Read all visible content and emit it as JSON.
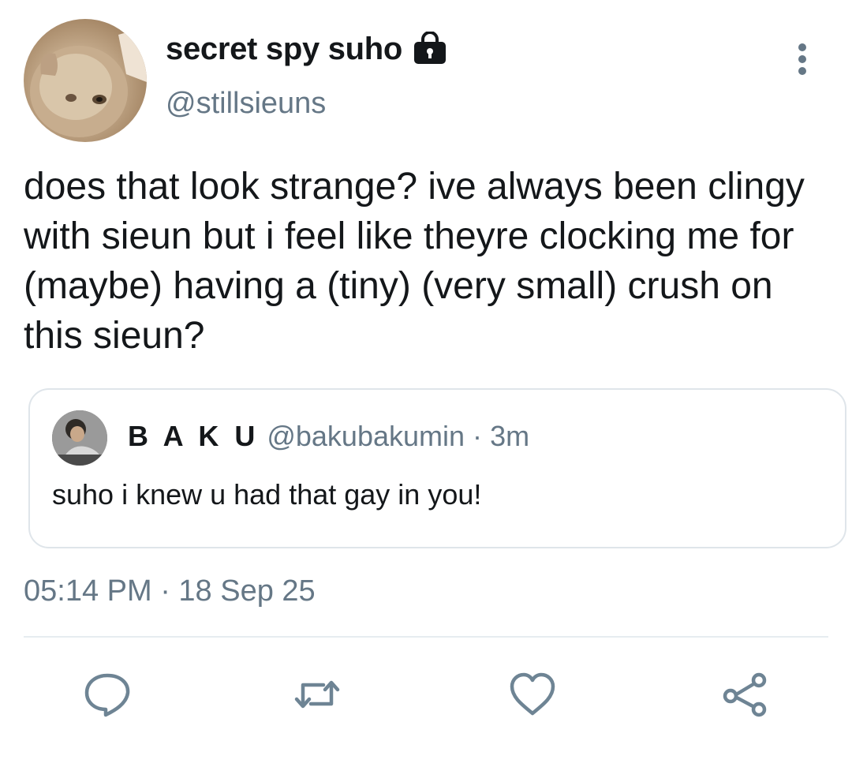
{
  "author": {
    "display_name": "secret spy suho",
    "handle": "@stillsieuns",
    "protected_icon": "lock-icon",
    "avatar_icon": "cat-avatar"
  },
  "menu_icon": "more-vertical-icon",
  "tweet": {
    "text": "does that look strange? ive always been clingy with sieun but i feel like theyre clocking me for (maybe) having a (tiny) (very small) crush on this sieun?",
    "timestamp": "05:14 PM · 18 Sep 25"
  },
  "quoted_tweet": {
    "name": "B A K U",
    "handle": "@bakubakumin",
    "separator": "·",
    "time": "3m",
    "text": "suho i knew u had that gay in you!",
    "avatar_icon": "user-photo-avatar"
  },
  "actions": [
    {
      "name": "reply",
      "icon": "speech-bubble-icon"
    },
    {
      "name": "retweet",
      "icon": "retweet-arrows-icon"
    },
    {
      "name": "like",
      "icon": "heart-icon"
    },
    {
      "name": "share",
      "icon": "share-nodes-icon"
    }
  ],
  "colors": {
    "text": "#14171a",
    "secondary": "#657786",
    "border": "#dfe5ea",
    "icon": "#6e8494"
  }
}
